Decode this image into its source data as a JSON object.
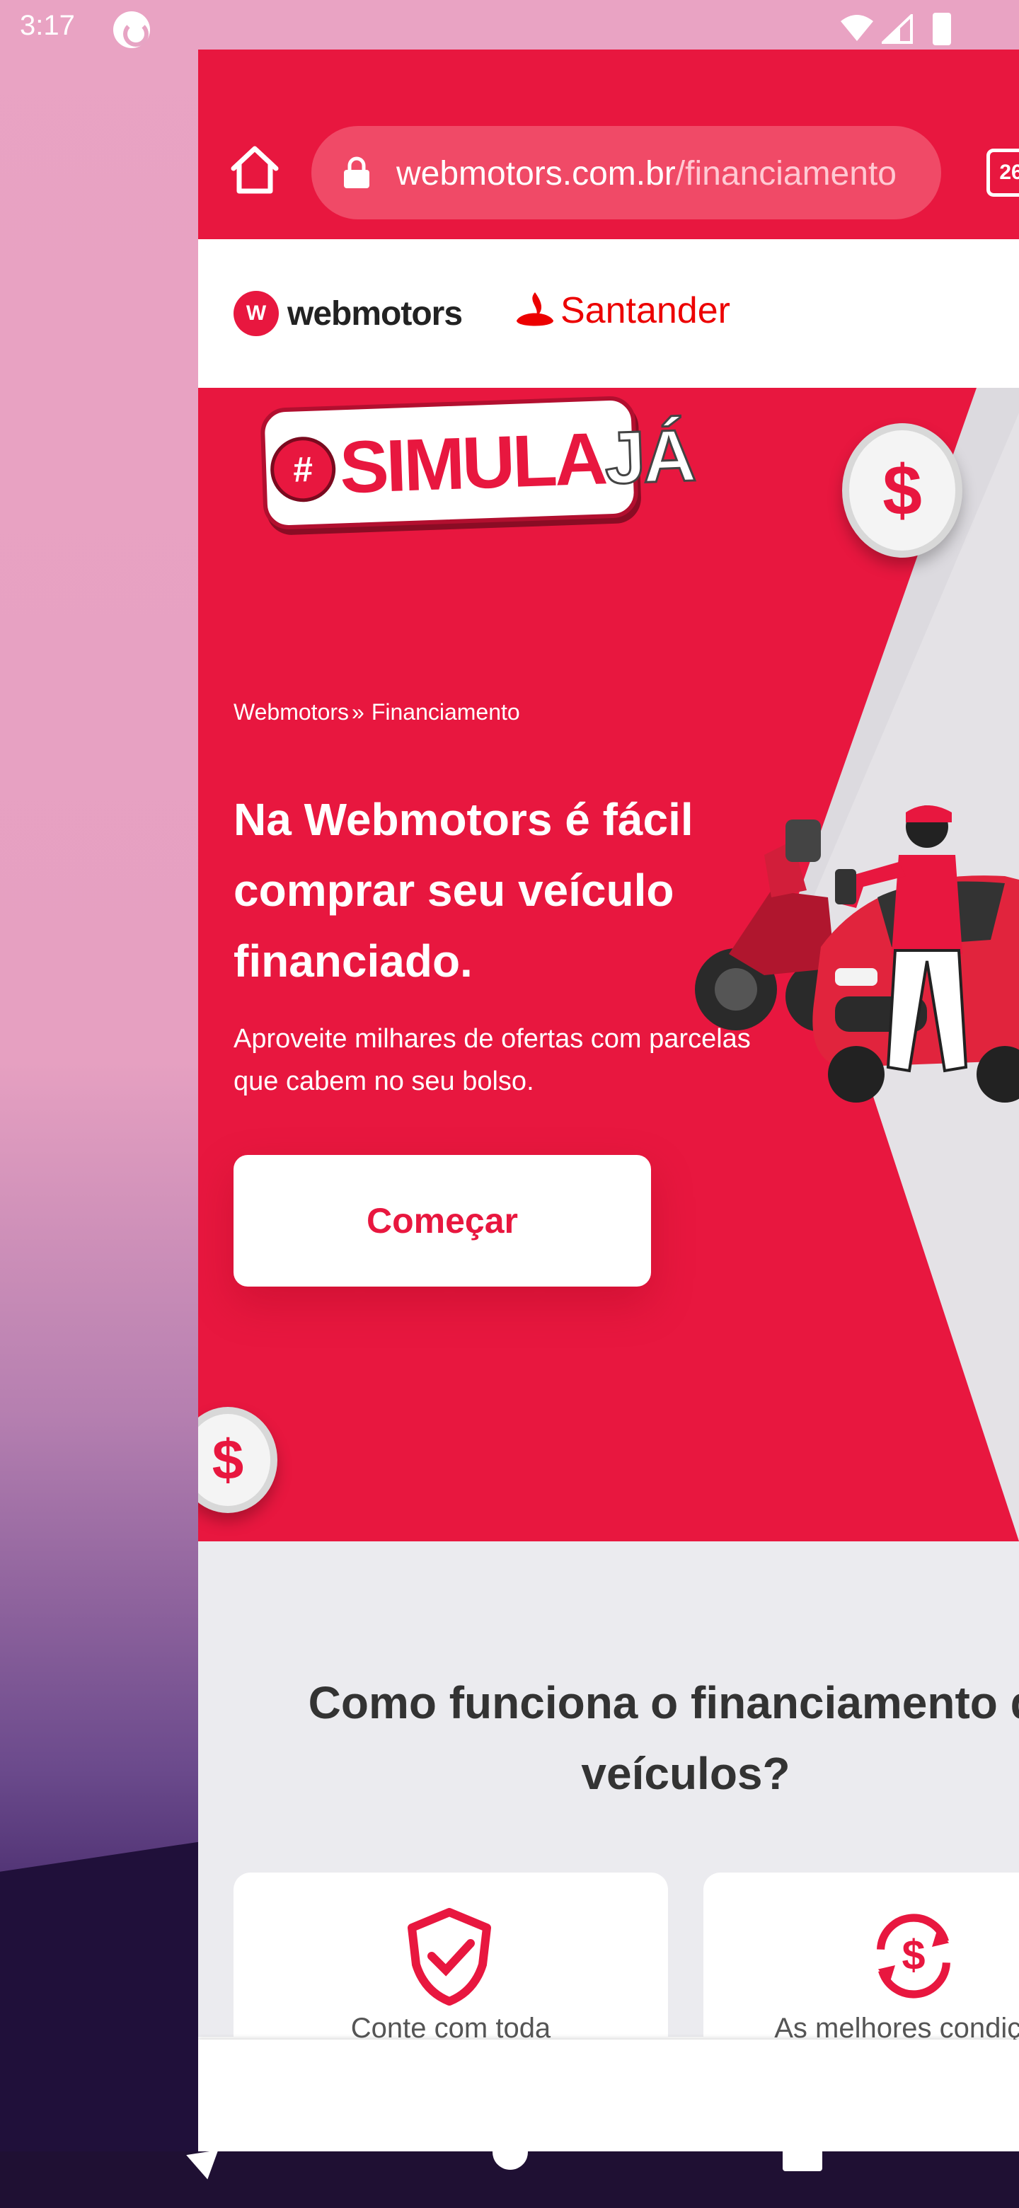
{
  "status_bar": {
    "time": "3:17"
  },
  "browser": {
    "url_domain": "webmotors.com.br",
    "url_path": "/financiamento",
    "tab_count": "26"
  },
  "brand": {
    "webmotors_mark": "W",
    "webmotors_name": "webmotors",
    "santander_name": "Santander"
  },
  "hero": {
    "badge_hash": "#",
    "badge_simula": "SIMULA",
    "badge_ja": "JÁ",
    "coin_symbol": "$",
    "breadcrumb": [
      "Webmotors",
      "»",
      "Financiamento"
    ],
    "title_lines": [
      "Na Webmotors é fácil",
      "comprar seu veículo",
      "financiado."
    ],
    "subtitle": "Aproveite milhares de ofertas com parcelas que cabem no seu bolso.",
    "cta_label": "Começar",
    "accent_color": "#e8173f"
  },
  "how_it_works": {
    "title_line1": "Como funciona o financiamento de",
    "title_line2": "veículos?",
    "cards": [
      {
        "label": "Conte com toda",
        "icon": "shield-check-icon"
      },
      {
        "label": "As melhores condições",
        "icon": "money-cycle-icon"
      }
    ]
  }
}
